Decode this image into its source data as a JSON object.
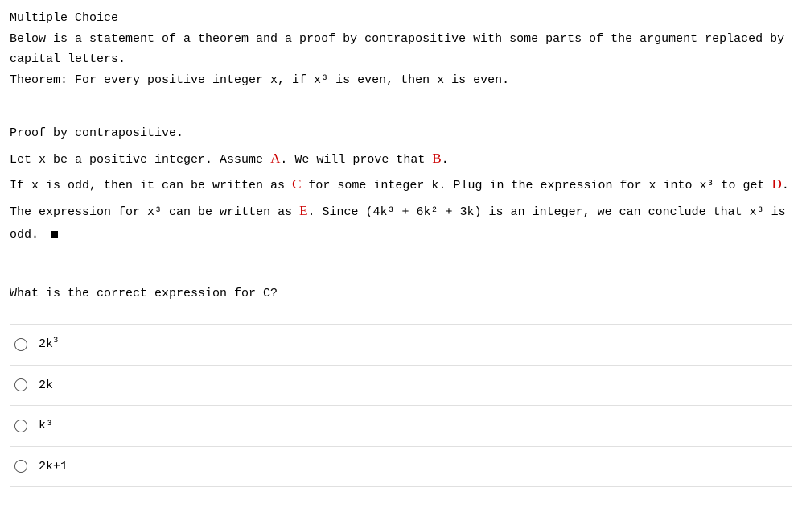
{
  "header": {
    "title": "Multiple Choice",
    "intro": "Below is a statement of a theorem and a proof by contrapositive with some parts of the argument replaced by capital letters.",
    "theorem_prefix": "Theorem: For every positive integer x, if x",
    "theorem_mid": " is even, then x is even."
  },
  "proof": {
    "line1": "Proof by contrapositive.",
    "l2_a": "Let x be a positive integer. Assume ",
    "A": "A",
    "l2_b": ". We will prove that ",
    "B": "B",
    "l2_c": ".",
    "l3_a": "If x is odd, then it can be written as ",
    "C": "C",
    "l3_b": " for some integer k. Plug in the expression for x into x",
    "l3_c": " to get ",
    "D": "D",
    "l3_d": ". The expression for x",
    "l3_e": " can be written as ",
    "E": "E",
    "l3_f": ". Since (4k",
    "l3_g": " + 6k",
    "l3_h": " + 3k) is an integer, we can conclude that x",
    "l3_i": " is odd.  "
  },
  "question": "What is the correct expression for C?",
  "options": [
    {
      "html": "2k<sup>3</sup>"
    },
    {
      "html": "2k"
    },
    {
      "html": "k<span class=\"sup3\"></span>"
    },
    {
      "html": "2k+1"
    }
  ]
}
